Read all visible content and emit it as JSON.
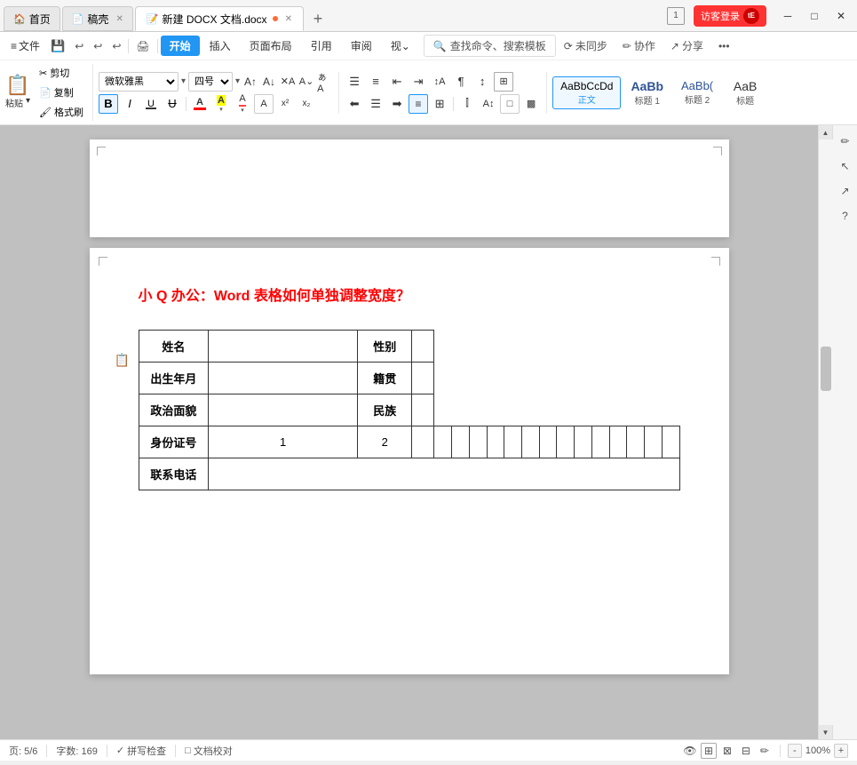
{
  "tabs": [
    {
      "label": "首页",
      "icon": "🏠",
      "active": false
    },
    {
      "label": "稿壳",
      "icon": "📄",
      "active": false
    },
    {
      "label": "新建 DOCX 文档.docx",
      "icon": "📝",
      "active": true
    }
  ],
  "tab_add": "+",
  "window": {
    "page_num_display": "1",
    "visitor_btn": "访客登录",
    "minimize": "─",
    "maximize": "□",
    "close": "✕"
  },
  "menu": {
    "items": [
      "≡ 文件",
      "⬛",
      "↩",
      "↩",
      "↩",
      "↩",
      "↪",
      "↪",
      "开始",
      "插入",
      "页面布局",
      "引用",
      "审阅",
      "视⌄",
      "🔍 查找命令、搜索模板",
      "⟳ 未同步",
      "✏ 协作",
      "↗ 分享",
      "•••"
    ]
  },
  "toolbar": {
    "font_name": "微软雅黑",
    "font_size": "四号",
    "paste_label": "粘贴",
    "cut_label": "剪切",
    "copy_label": "复制",
    "format_label": "格式刷",
    "bold": "B",
    "italic": "I",
    "underline": "U",
    "strikethrough": "U",
    "font_color_a": "A",
    "highlight": "A",
    "format_btn": "A",
    "superscript": "x²",
    "subscript": "x₂",
    "font_color": "A",
    "row1_right_btns": [
      "🔍 查找命令、搜索模板",
      "⟳ 未同步",
      "✏ 协作",
      "↗ 分享",
      "•••"
    ]
  },
  "styles": [
    {
      "label": "正文",
      "text": "AaBbCcDd",
      "active": true,
      "color": "#000"
    },
    {
      "label": "标题 1",
      "text": "AaBb",
      "color": "#2f5496"
    },
    {
      "label": "标题 2",
      "text": "AaBb(",
      "color": "#2f5496"
    },
    {
      "label": "标题",
      "text": "AaB",
      "color": "#333"
    }
  ],
  "document": {
    "title": "小 Q 办公：Word 表格如何单独调整宽度？",
    "table": {
      "rows": [
        [
          {
            "text": "姓名",
            "label": true
          },
          {
            "text": "",
            "label": false,
            "wide": true
          },
          {
            "text": "性别",
            "label": true
          },
          {
            "text": "",
            "label": false,
            "wide": true
          }
        ],
        [
          {
            "text": "出生年月",
            "label": true
          },
          {
            "text": "",
            "label": false,
            "wide": true
          },
          {
            "text": "籍贯",
            "label": true
          },
          {
            "text": "",
            "label": false,
            "wide": true
          }
        ],
        [
          {
            "text": "政治面貌",
            "label": true
          },
          {
            "text": "",
            "label": false,
            "wide": true
          },
          {
            "text": "民族",
            "label": true
          },
          {
            "text": "",
            "label": false,
            "wide": true
          }
        ],
        [
          {
            "text": "身份证号",
            "label": true,
            "id_row": true
          },
          {
            "text": "1",
            "id_cell": true
          },
          {
            "text": "2",
            "id_cell": true
          },
          {
            "text": "",
            "id_cell": true
          },
          {
            "text": "",
            "id_cell": true
          },
          {
            "text": "",
            "id_cell": true
          },
          {
            "text": "",
            "id_cell": true
          },
          {
            "text": "",
            "id_cell": true
          },
          {
            "text": "",
            "id_cell": true
          },
          {
            "text": "",
            "id_cell": true
          },
          {
            "text": "",
            "id_cell": true
          },
          {
            "text": "",
            "id_cell": true
          },
          {
            "text": "",
            "id_cell": true
          },
          {
            "text": "",
            "id_cell": true
          },
          {
            "text": "",
            "id_cell": true
          },
          {
            "text": "",
            "id_cell": true
          },
          {
            "text": "",
            "id_cell": true
          },
          {
            "text": "",
            "id_cell": true
          }
        ],
        [
          {
            "text": "联系电话",
            "label": true
          },
          {
            "text": "",
            "label": false,
            "full": true
          }
        ]
      ]
    }
  },
  "status": {
    "pages": "页: 5/6",
    "words": "字数: 169",
    "spell": "✓ 拼写检查",
    "doc_check": "□ 文档校对",
    "zoom": "100%",
    "zoom_in": "+",
    "zoom_out": "-"
  },
  "right_tools": [
    "✏",
    "↖",
    "↗",
    "?"
  ]
}
